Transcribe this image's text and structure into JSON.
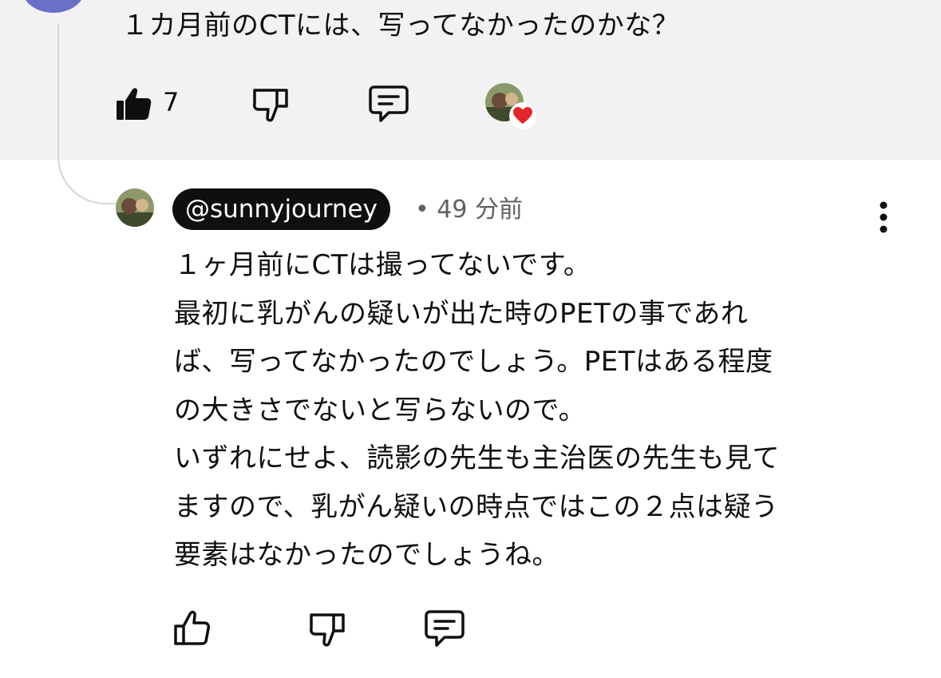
{
  "parent_comment": {
    "text": "１カ月前のCTには、写ってなかったのかな？",
    "like_count": "7"
  },
  "reply": {
    "handle": "@sunnyjourney",
    "separator": "•",
    "time": "49 分前",
    "lines": [
      "１ヶ月前にCTは撮ってないです。",
      "最初に乳がんの疑いが出た時のPETの事であれ",
      "ば、写ってなかったのでしょう。PETはある程度",
      "の大きさでないと写らないので。",
      "いずれにせよ、読影の先生も主治医の先生も見て",
      "ますので、乳がん疑いの時点ではこの２点は疑う",
      "要素はなかったのでしょうね。"
    ]
  },
  "icons": {
    "like": "thumbs-up-icon",
    "dislike": "thumbs-down-icon",
    "reply": "comment-icon",
    "more": "more-vertical-icon",
    "heart": "heart-icon"
  },
  "colors": {
    "top_background": "#f2f2f2",
    "heart": "#e5252c",
    "handle_pill": "#0f0f0f",
    "meta_text": "#606060"
  }
}
